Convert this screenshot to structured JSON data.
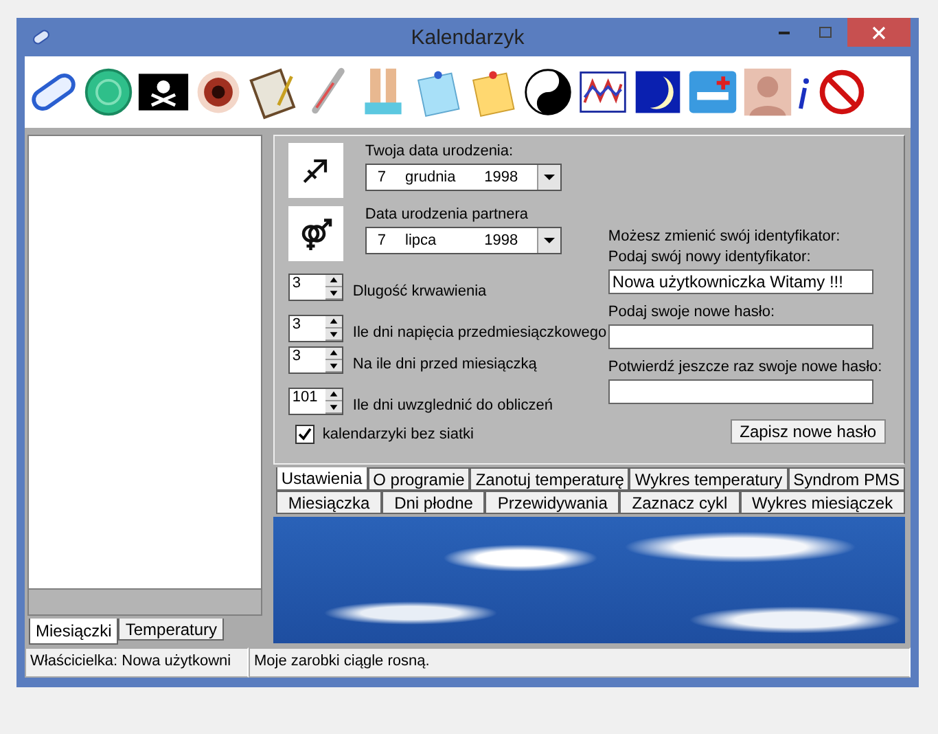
{
  "window": {
    "title": "Kalendarzyk"
  },
  "side_panel": {
    "tabs": [
      {
        "label": "Miesiączki",
        "selected": true
      },
      {
        "label": "Temperatury",
        "selected": false
      }
    ]
  },
  "settings": {
    "birth_date": {
      "label": "Twoja data urodzenia:",
      "day": "7",
      "month": "grudnia",
      "year": "1998"
    },
    "partner_date": {
      "label": "Data urodzenia partnera",
      "day": "7",
      "month": "lipca",
      "year": "1998"
    },
    "spinners": [
      {
        "value": "3",
        "label": "Dlugość krwawienia"
      },
      {
        "value": "3",
        "label": "Ile dni napięcia przedmiesiączkowego"
      },
      {
        "value": "3",
        "label": "Na ile dni przed miesiączką"
      },
      {
        "value": "101",
        "label": "Ile dni uwzglednić  do obliczeń"
      }
    ],
    "checkbox": {
      "label": "kalendarzyki bez siatki",
      "checked": true
    },
    "identity": {
      "intro": "Możesz zmienić swój identyfikator:",
      "id_label": "Podaj swój nowy identyfikator:",
      "id_value": "Nowa użytkowniczka Witamy !!!",
      "password_label": "Podaj swoje nowe hasło:",
      "confirm_label": "Potwierdź jeszcze raz swoje nowe hasło:",
      "save_button": "Zapisz nowe hasło"
    }
  },
  "tab_rows": [
    [
      {
        "label": "Ustawienia",
        "selected": true
      },
      {
        "label": "O programie",
        "selected": false
      },
      {
        "label": "Zanotuj temperaturę",
        "selected": false
      },
      {
        "label": "Wykres temperatury",
        "selected": false
      },
      {
        "label": "Syndrom PMS",
        "selected": false
      }
    ],
    [
      {
        "label": "Miesiączka",
        "selected": false
      },
      {
        "label": "Dni płodne",
        "selected": false
      },
      {
        "label": "Przewidywania",
        "selected": false
      },
      {
        "label": "Zaznacz cykl",
        "selected": false
      },
      {
        "label": "Wykres miesiączek",
        "selected": false
      }
    ]
  ],
  "status_bar": [
    "Właścicielka: Nowa użytkowni",
    "Moje zarobki ciągle rosną."
  ]
}
